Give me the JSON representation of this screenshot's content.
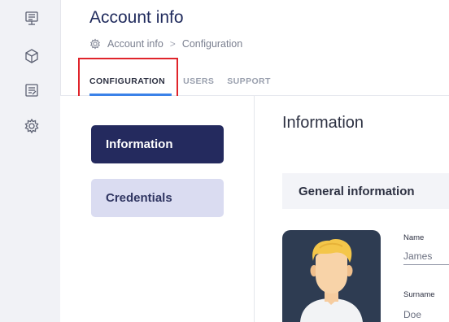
{
  "header": {
    "title": "Account info",
    "breadcrumb": {
      "root": "Account info",
      "separator": ">",
      "current": "Configuration"
    }
  },
  "tabs": [
    {
      "label": "CONFIGURATION",
      "active": true
    },
    {
      "label": "USERS",
      "active": false
    },
    {
      "label": "SUPPORT",
      "active": false
    }
  ],
  "rail": {
    "icons": [
      "dashboard-icon",
      "package-icon",
      "document-icon",
      "settings-icon"
    ]
  },
  "subnav": {
    "items": [
      {
        "label": "Information",
        "active": true
      },
      {
        "label": "Credentials",
        "active": false
      }
    ]
  },
  "main": {
    "section_title": "Information",
    "card_title": "General information",
    "fields": [
      {
        "label": "Name",
        "value": "James"
      },
      {
        "label": "Surname",
        "value": "Doe"
      }
    ]
  },
  "colors": {
    "accent": "#3b82e8",
    "nav_active": "#242a5e",
    "nav_inactive": "#dadcf1",
    "highlight": "#e0242b",
    "avatar_bg": "#2e3c52"
  }
}
